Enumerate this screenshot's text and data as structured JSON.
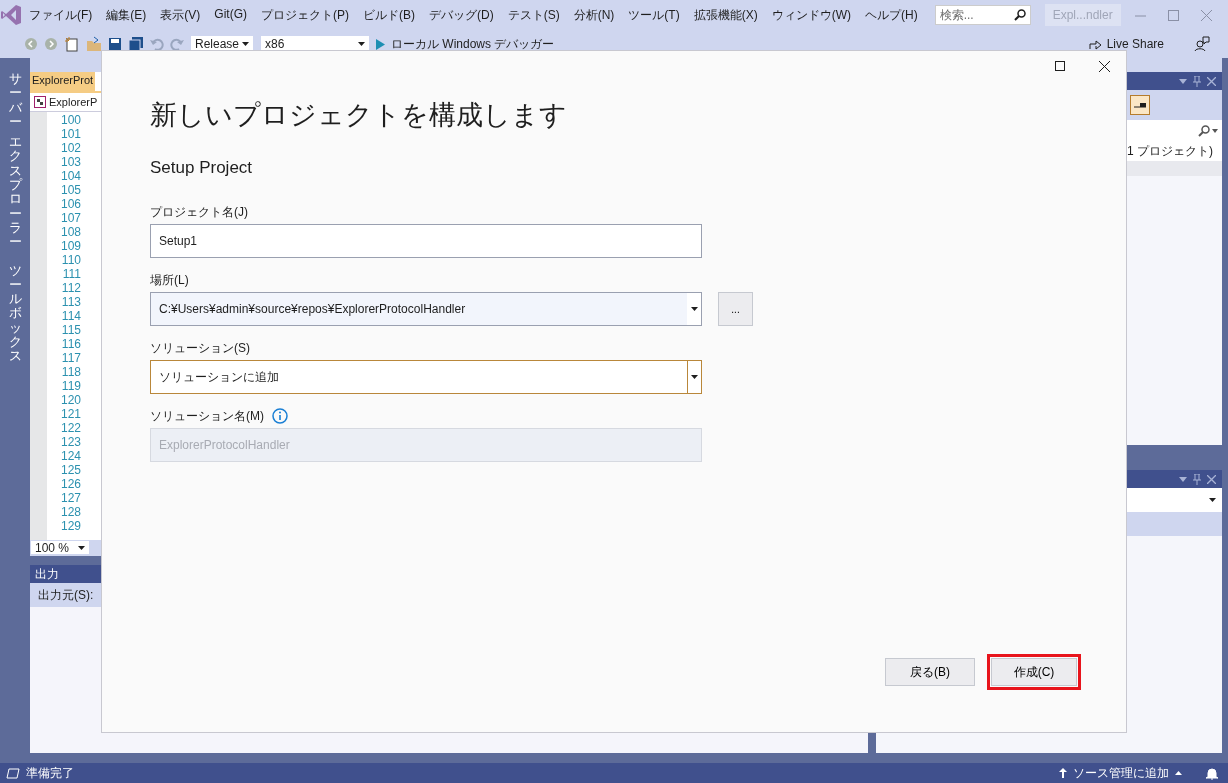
{
  "title_bar": {
    "menu": [
      "ファイル(F)",
      "編集(E)",
      "表示(V)",
      "Git(G)",
      "プロジェクト(P)",
      "ビルド(B)",
      "デバッグ(D)",
      "テスト(S)",
      "分析(N)",
      "ツール(T)",
      "拡張機能(X)",
      "ウィンドウ(W)",
      "ヘルプ(H)"
    ],
    "search": {
      "placeholder": "検索..."
    },
    "solution_badge": "Expl...ndler"
  },
  "toolbar": {
    "configuration": "Release",
    "platform": "x86",
    "debugger": "ローカル Windows デバッガー",
    "live_share": "Live Share"
  },
  "side_tabs": [
    {
      "words": [
        "サーバー",
        "エクスプローラー"
      ]
    },
    {
      "words": [
        "ツールボックス"
      ]
    }
  ],
  "editor": {
    "tab": "ExplorerProt",
    "navigation": "ExplorerP",
    "line_numbers": [
      "100",
      "101",
      "102",
      "103",
      "104",
      "105",
      "106",
      "107",
      "108",
      "109",
      "110",
      "111",
      "112",
      "113",
      "114",
      "115",
      "116",
      "117",
      "118",
      "119",
      "120",
      "121",
      "122",
      "123",
      "124",
      "125",
      "126",
      "127",
      "128",
      "129"
    ],
    "zoom": "100 %"
  },
  "output_panel": {
    "title": "出力",
    "source_label": "出力元(S):"
  },
  "right_panel": {
    "tree_item": "1 プロジェクト)"
  },
  "dialog": {
    "title": "新しいプロジェクトを構成します",
    "template": "Setup Project",
    "fields": [
      {
        "kind": "text",
        "label": "プロジェクト名(J)",
        "value": "Setup1"
      },
      {
        "kind": "combo",
        "label": "場所(L)",
        "value": "C:¥Users¥admin¥source¥repos¥ExplorerProtocolHandler",
        "browse": "..."
      },
      {
        "kind": "dropdown",
        "label": "ソリューション(S)",
        "value": "ソリューションに追加",
        "focused": true
      },
      {
        "kind": "text",
        "label": "ソリューション名(M)",
        "info": true,
        "value": "ExplorerProtocolHandler",
        "disabled": true
      }
    ],
    "buttons": [
      {
        "label": "戻る(B)",
        "highlighted": false
      },
      {
        "label": "作成(C)",
        "highlighted": true
      }
    ]
  },
  "status_bar": {
    "message": "準備完了",
    "source_control": "ソース管理に追加"
  }
}
